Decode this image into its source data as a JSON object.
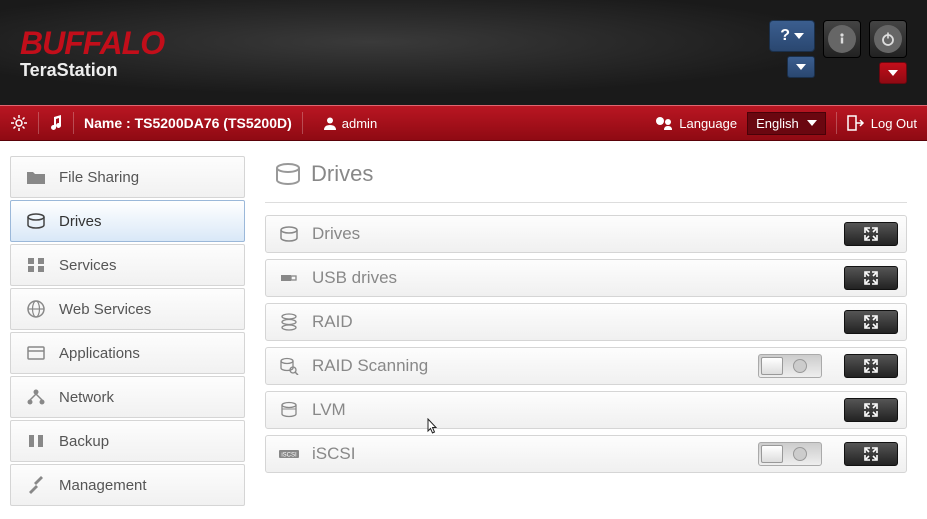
{
  "brand": {
    "logo": "BUFFALO",
    "product": "TeraStation"
  },
  "header": {
    "help_label": "?",
    "info_tooltip": "Info",
    "power_tooltip": "Power"
  },
  "redbar": {
    "name_label": "Name :",
    "device_name": "TS5200DA76 (TS5200D)",
    "user": "admin",
    "language_label": "Language",
    "language_value": "English",
    "logout": "Log Out"
  },
  "sidebar": {
    "items": [
      {
        "label": "File Sharing"
      },
      {
        "label": "Drives"
      },
      {
        "label": "Services"
      },
      {
        "label": "Web Services"
      },
      {
        "label": "Applications"
      },
      {
        "label": "Network"
      },
      {
        "label": "Backup"
      },
      {
        "label": "Management"
      }
    ]
  },
  "page": {
    "title": "Drives",
    "rows": [
      {
        "label": "Drives",
        "has_toggle": false
      },
      {
        "label": "USB drives",
        "has_toggle": false
      },
      {
        "label": "RAID",
        "has_toggle": false
      },
      {
        "label": "RAID Scanning",
        "has_toggle": true
      },
      {
        "label": "LVM",
        "has_toggle": false
      },
      {
        "label": "iSCSI",
        "has_toggle": true
      }
    ]
  }
}
